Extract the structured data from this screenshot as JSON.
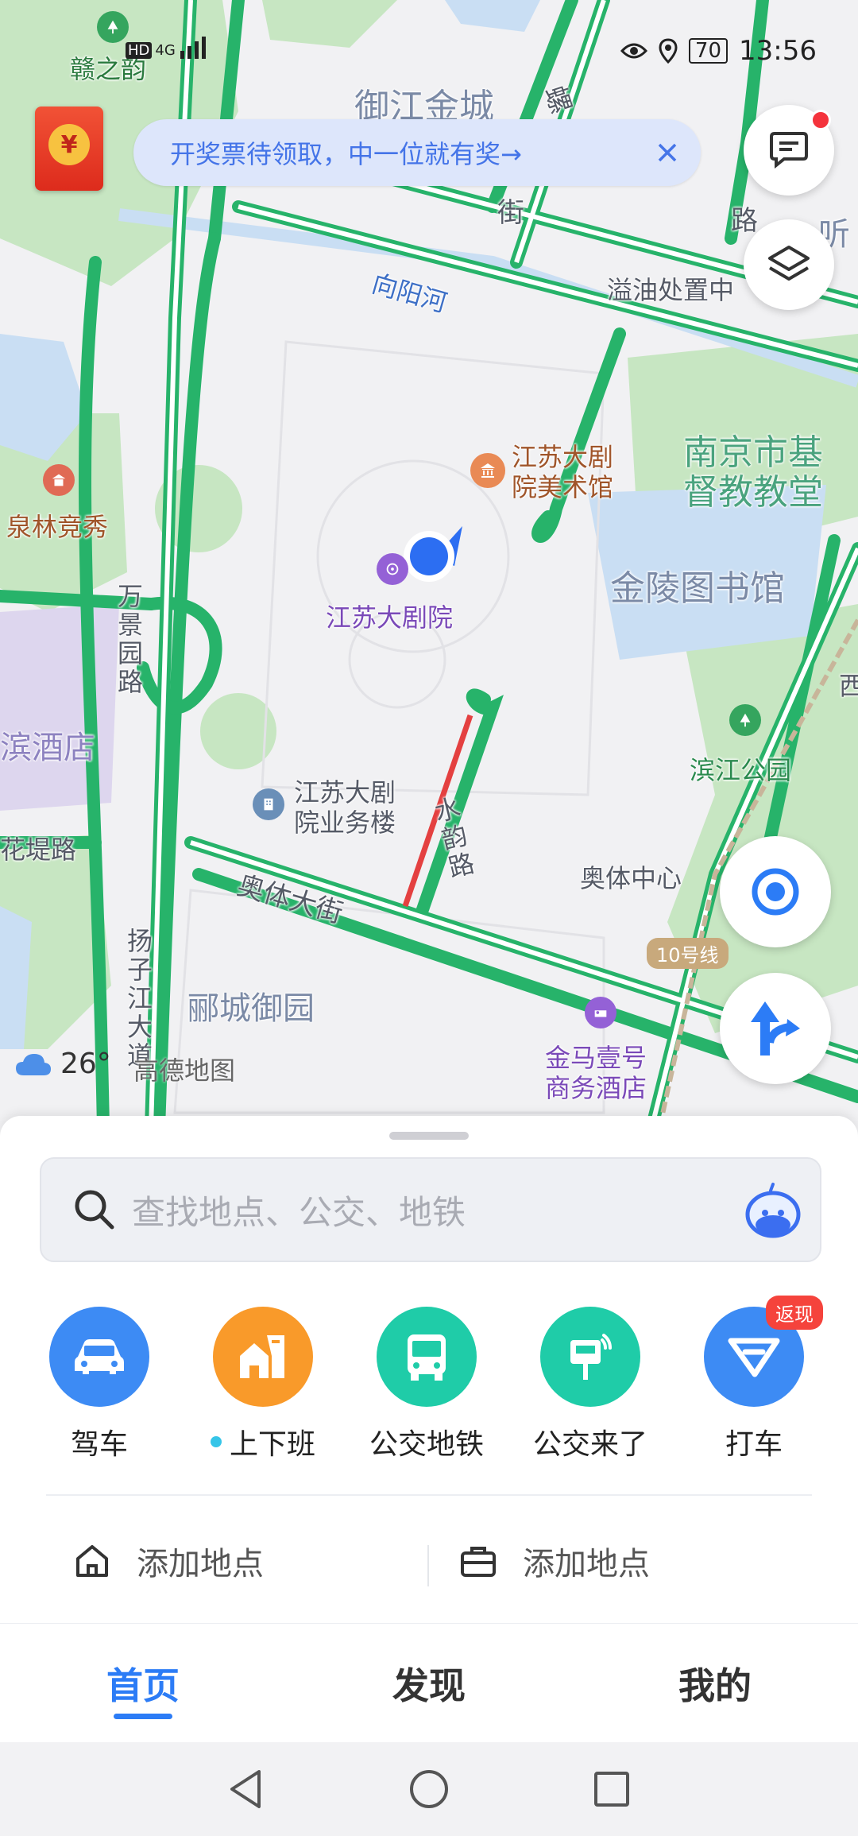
{
  "status_bar": {
    "battery": "70",
    "time": "13:56",
    "network": "4G"
  },
  "promo": {
    "red_packet_symbol": "¥",
    "banner_text": "开奖票待领取，中一位就有奖→",
    "close_symbol": "✕"
  },
  "map": {
    "labels": {
      "ganzhiyun": "赣之韵",
      "yujiang_jincheng": "御江金城",
      "luo": "螺",
      "jie": "街",
      "lu_top": "路",
      "ting": "听",
      "xiangyanghe": "向阳河",
      "yiyouchu": "溢油处置中",
      "nanjing_church": "南京市基\n督教教堂",
      "quanlin": "泉林竞秀",
      "jiangsu_art_museum": "江苏大剧\n院美术馆",
      "jiangsu_theatre": "江苏大剧院",
      "jinling_library": "金陵图书馆",
      "wanjingyuan": "万\n景\n园\n路",
      "binjiang_park": "滨江公园",
      "hotel": "滨酒店",
      "jiangsu_business": "江苏大剧\n院业务楼",
      "shuiyun": "水\n韵\n路",
      "huadilu": "花堤路",
      "aoti_street": "奥体大街",
      "aoti_center": "奥体中心",
      "line10": "10号线",
      "yangzijiang": "扬\n子\n江\n大\n道",
      "yicheng": "郦城御园",
      "jinma_hotel": "金马壹号\n商务酒店",
      "xi": "西"
    }
  },
  "weather": {
    "temp": "26°"
  },
  "brand": "高德地图",
  "search": {
    "placeholder": "查找地点、公交、地铁"
  },
  "quick_actions": [
    {
      "label": "驾车",
      "icon": "car-icon",
      "color": "#3d8bf4"
    },
    {
      "label": "上下班",
      "icon": "commute-icon",
      "color": "#f99a2a",
      "dot": true
    },
    {
      "label": "公交地铁",
      "icon": "bus-icon",
      "color": "#1fcca8"
    },
    {
      "label": "公交来了",
      "icon": "bus-stop-icon",
      "color": "#1fcca8"
    },
    {
      "label": "打车",
      "icon": "taxi-icon",
      "color": "#3d8bf4",
      "badge": "返现"
    }
  ],
  "places": {
    "home": "添加地点",
    "work": "添加地点"
  },
  "tabs": {
    "home": "首页",
    "discover": "发现",
    "mine": "我的"
  },
  "colors": {
    "accent": "#2c7cf6",
    "road": "#27b36a",
    "water": "#c9def3",
    "park": "#c7e6c2"
  }
}
